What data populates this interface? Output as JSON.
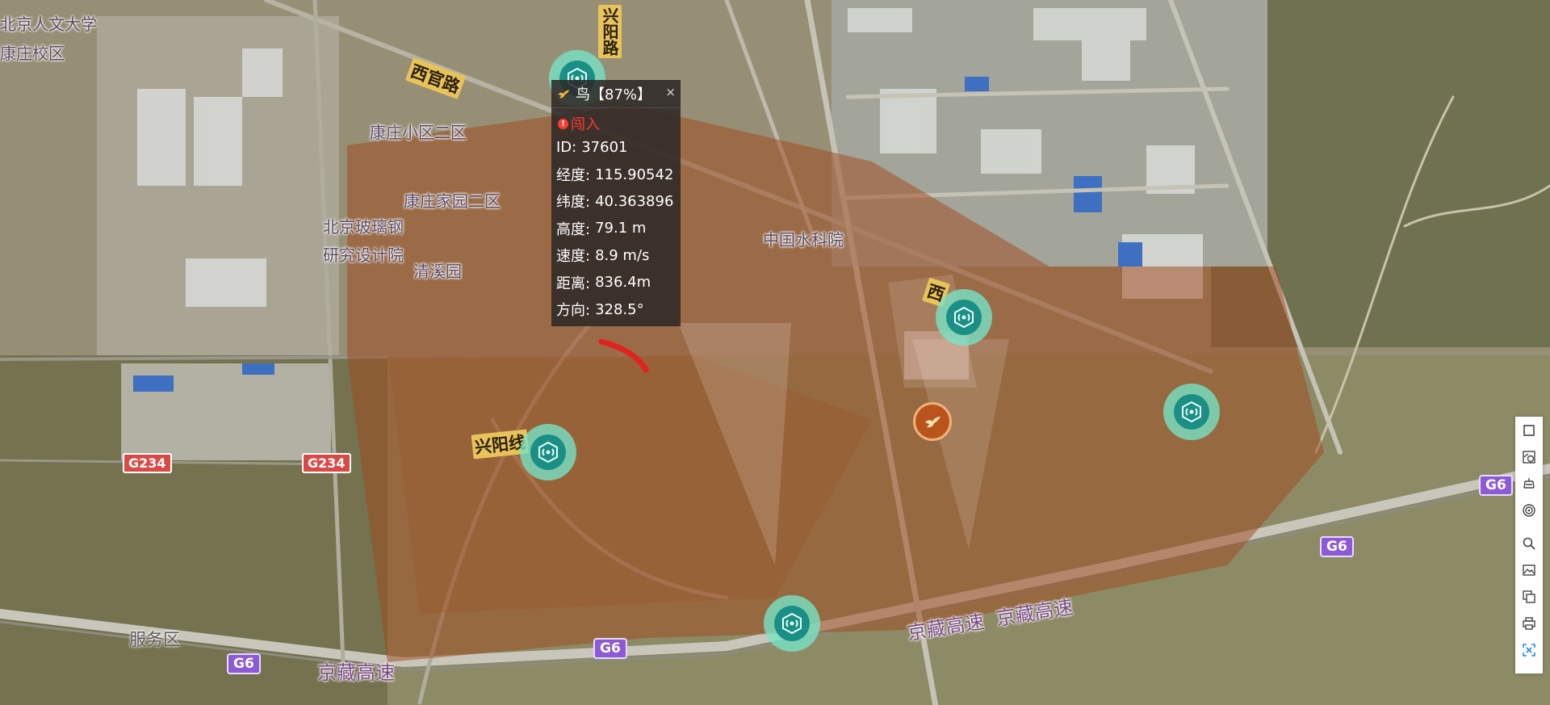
{
  "map": {
    "place_labels": {
      "university_line1": "北京人文大学",
      "university_line2": "康庄校区",
      "community_2": "康庄小区二区",
      "home_2": "康庄家园二区",
      "glass_line1": "北京玻璃钢",
      "glass_line2": "研究设计院",
      "qingxi": "清溪园",
      "water": "中国水科院",
      "service": "服务区"
    },
    "road_labels": {
      "xiguan_road": "西官路",
      "xingyang_v": "兴阳路",
      "xingyang_line": "兴阳线",
      "west_partial": "西",
      "jingzang_1": "京藏高速",
      "jingzang_2": "京藏高速",
      "jingzang_3": "京藏高速"
    },
    "shields": {
      "g234_a": "G234",
      "g234_b": "G234",
      "g6_a": "G6",
      "g6_b": "G6",
      "g6_c": "G6",
      "g6_d": "G6"
    },
    "markers": {
      "radars": [
        {
          "name": "radar-station-1",
          "icon": "radar-icon"
        },
        {
          "name": "radar-station-2",
          "icon": "radar-icon"
        },
        {
          "name": "radar-station-3",
          "icon": "radar-icon"
        },
        {
          "name": "radar-station-4",
          "icon": "radar-icon"
        },
        {
          "name": "radar-station-5",
          "icon": "radar-icon"
        }
      ],
      "target": {
        "icon": "bird-icon",
        "color": "#b9541d"
      }
    },
    "zone_color": "#a0481c"
  },
  "popup": {
    "title_icon": "bird-icon",
    "title": "鸟【87%】",
    "close": "×",
    "alert": "闯入",
    "alert_color": "#ff3b30",
    "rows": [
      {
        "key": "ID:",
        "value": "37601"
      },
      {
        "key": "经度:",
        "value": "115.90542"
      },
      {
        "key": "纬度:",
        "value": "40.363896"
      },
      {
        "key": "高度:",
        "value": "79.1 m"
      },
      {
        "key": "速度:",
        "value": "8.9 m/s"
      },
      {
        "key": "距离:",
        "value": "836.4m"
      },
      {
        "key": "方向:",
        "value": "328.5°"
      }
    ]
  },
  "toolbar": {
    "tools": [
      {
        "name": "draw-rectangle-icon"
      },
      {
        "name": "edit-shape-icon"
      },
      {
        "name": "measure-icon"
      },
      {
        "name": "radar-range-icon"
      },
      {
        "name": "search-icon"
      },
      {
        "name": "picture-icon"
      },
      {
        "name": "layers-icon"
      },
      {
        "name": "printer-icon"
      },
      {
        "name": "fullscreen-icon",
        "active": true
      }
    ],
    "active_color": "#1e8ee8"
  }
}
